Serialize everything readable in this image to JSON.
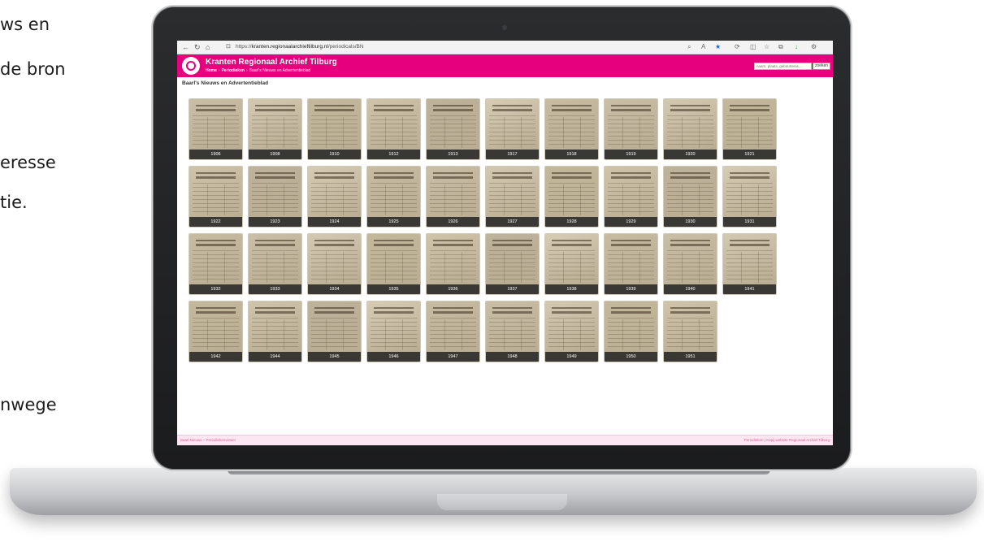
{
  "side_text": [
    "ws en",
    "de bron",
    "eresse",
    "tie.",
    "nwege"
  ],
  "browser": {
    "url_prefix": "https://",
    "url_host": "kranten.regionaalarchieftilburg.nl",
    "url_path": "/periodicals/BN"
  },
  "site": {
    "title": "Kranten Regionaal Archief Tilburg",
    "breadcrumb": [
      "Home",
      "Periodieken",
      "Baarl's Nieuws en Advertentieblad"
    ],
    "search_placeholder": "naam, plaats, gebeurtenis,...",
    "search_button": "zoeken"
  },
  "page_title": "Baarl's Nieuws en Advertentieblad",
  "issues": [
    "1906",
    "1908",
    "1910",
    "1912",
    "1913",
    "1917",
    "1918",
    "1919",
    "1920",
    "1921",
    "1922",
    "1923",
    "1924",
    "1925",
    "1926",
    "1927",
    "1928",
    "1929",
    "1930",
    "1931",
    "1932",
    "1933",
    "1934",
    "1935",
    "1936",
    "1937",
    "1938",
    "1939",
    "1940",
    "1941",
    "1942",
    "1944",
    "1945",
    "1946",
    "1947",
    "1948",
    "1949",
    "1950",
    "1951"
  ],
  "footer": {
    "left": "Baarl Nieuws – Periodiekenviewer",
    "right": "Periodieken | Kopij website Regionaal Archief Tilburg"
  },
  "colors": {
    "brand": "#e6007e",
    "year_bar": "#3a3835"
  }
}
